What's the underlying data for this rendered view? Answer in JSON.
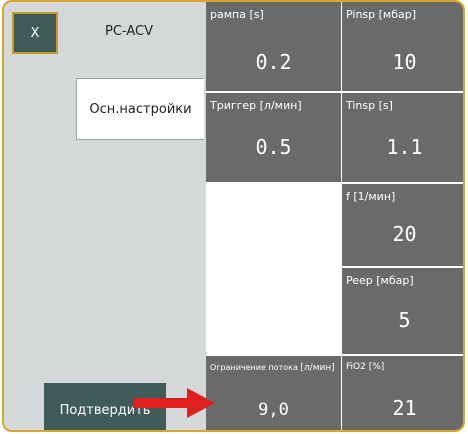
{
  "header": {
    "close_label": "X",
    "mode_title": "PC-ACV"
  },
  "tabs": {
    "basic_settings": "Осн.настройки"
  },
  "footer": {
    "confirm_label": "Подтвердить"
  },
  "params": {
    "ramp": {
      "label": "рампа [s]",
      "value": "0.2"
    },
    "pinsp": {
      "label": "Pinsp [мбар]",
      "value": "10"
    },
    "trigger": {
      "label": "Триггер [л/мин]",
      "value": "0.5"
    },
    "tinsp": {
      "label": "Tinsp [s]",
      "value": "1.1"
    },
    "f": {
      "label": "f [1/мин]",
      "value": "20"
    },
    "peep": {
      "label": "Peep [мбар]",
      "value": "5"
    },
    "flow_limit": {
      "label": "Ограничение потока",
      "unit": "[л/мин]",
      "value": "9,0"
    },
    "fio2": {
      "label": "FiO2 [%]",
      "value": "21"
    }
  },
  "colors": {
    "tile_bg": "#6a6a6a",
    "button_bg": "#3f5c5a",
    "accent_border": "#d4a62a",
    "arrow": "#e0201e",
    "left_panel_bg": "#d5d8d9"
  }
}
